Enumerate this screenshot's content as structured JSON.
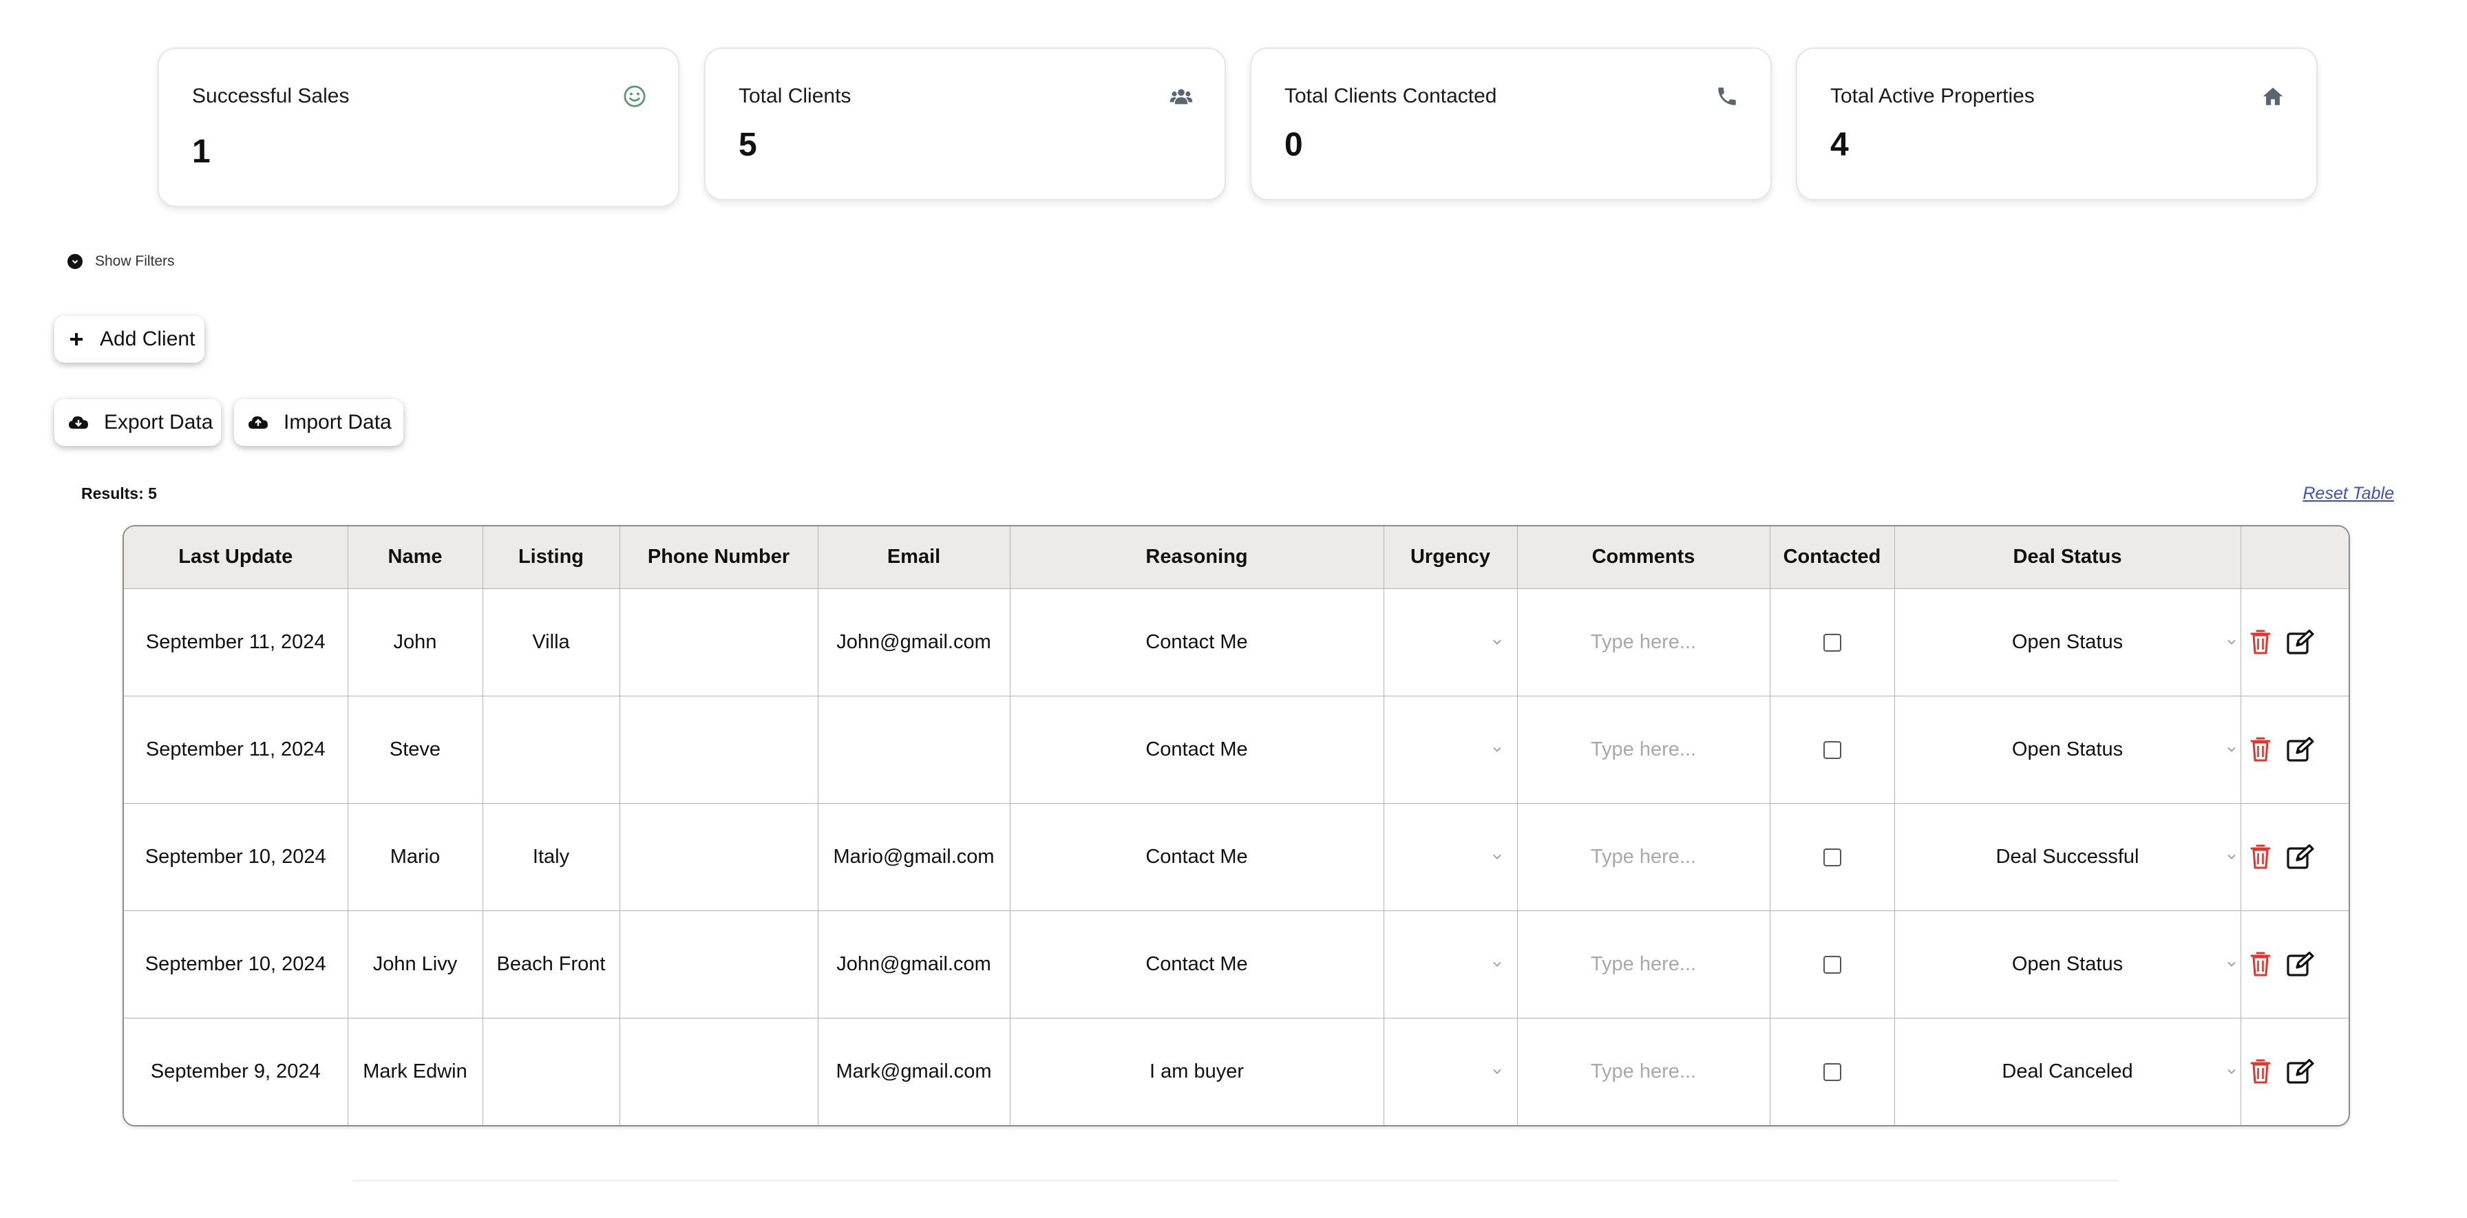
{
  "stats": [
    {
      "label": "Successful Sales",
      "value": "1",
      "icon": "smile-icon",
      "icon_color": "#5c9b74"
    },
    {
      "label": "Total Clients",
      "value": "5",
      "icon": "users-icon",
      "icon_color": "#5b6472"
    },
    {
      "label": "Total Clients Contacted",
      "value": "0",
      "icon": "phone-icon",
      "icon_color": "#5b6472"
    },
    {
      "label": "Total Active Properties",
      "value": "4",
      "icon": "home-icon",
      "icon_color": "#5b6472"
    }
  ],
  "filters": {
    "toggle_label": "Show Filters"
  },
  "actions": {
    "add_client": "Add Client",
    "export_data": "Export Data",
    "import_data": "Import Data"
  },
  "results_label": "Results: 5",
  "reset_table": "Reset Table",
  "table": {
    "columns": [
      "Last Update",
      "Name",
      "Listing",
      "Phone Number",
      "Email",
      "Reasoning",
      "Urgency",
      "Comments",
      "Contacted",
      "Deal Status",
      ""
    ],
    "comment_placeholder": "Type here...",
    "rows": [
      {
        "last_update": "September 11, 2024",
        "name": "John",
        "listing": "Villa",
        "phone": "",
        "email": "John@gmail.com",
        "reasoning": "Contact Me",
        "urgency": "",
        "contacted": false,
        "deal_status": "Open Status"
      },
      {
        "last_update": "September 11, 2024",
        "name": "Steve",
        "listing": "",
        "phone": "",
        "email": "",
        "reasoning": "Contact Me",
        "urgency": "",
        "contacted": false,
        "deal_status": "Open Status"
      },
      {
        "last_update": "September 10, 2024",
        "name": "Mario",
        "listing": "Italy",
        "phone": "",
        "email": "Mario@gmail.com",
        "reasoning": "Contact Me",
        "urgency": "",
        "contacted": false,
        "deal_status": "Deal Successful"
      },
      {
        "last_update": "September 10, 2024",
        "name": "John Livy",
        "listing": "Beach Front",
        "phone": "",
        "email": "John@gmail.com",
        "reasoning": "Contact Me",
        "urgency": "",
        "contacted": false,
        "deal_status": "Open Status"
      },
      {
        "last_update": "September 9, 2024",
        "name": "Mark Edwin",
        "listing": "",
        "phone": "",
        "email": "Mark@gmail.com",
        "reasoning": "I am buyer",
        "urgency": "",
        "contacted": false,
        "deal_status": "Deal Canceled"
      }
    ]
  },
  "colors": {
    "delete": "#e0362c",
    "link": "#3a4fc9",
    "header_bg": "#ecebea"
  }
}
